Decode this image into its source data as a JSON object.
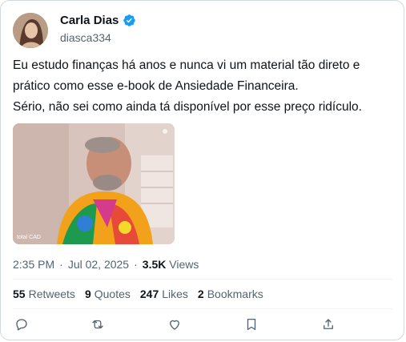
{
  "author": {
    "name": "Carla Dias",
    "handle": "diasca334",
    "verified": true
  },
  "tweet": {
    "lines": [
      "Eu estudo finanças há anos e nunca vi um material tão direto e",
      "prático como esse e-book de Ansiedade Financeira.",
      "Sério, não sei como ainda tá disponível por esse preço ridículo."
    ],
    "media_watermark": "total CAD"
  },
  "meta": {
    "time": "2:35 PM",
    "date": "Jul 02, 2025",
    "views_count": "3.5K",
    "views_label": "Views"
  },
  "stats": {
    "retweets_count": "55",
    "retweets_label": "Retweets",
    "quotes_count": "9",
    "quotes_label": "Quotes",
    "likes_count": "247",
    "likes_label": "Likes",
    "bookmarks_count": "2",
    "bookmarks_label": "Bookmarks"
  },
  "actions": [
    "reply-icon",
    "retweet-icon",
    "like-icon",
    "bookmark-icon",
    "share-icon"
  ],
  "colors": {
    "verified": "#1d9bf0",
    "text": "#0f1419",
    "muted": "#536471",
    "border": "#cfd9de"
  }
}
